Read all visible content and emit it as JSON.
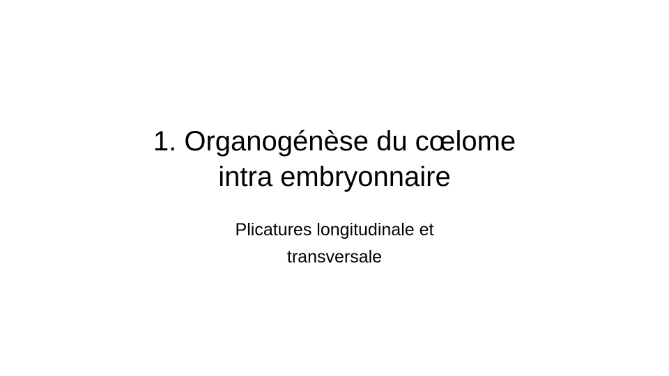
{
  "slide": {
    "title_lines": [
      "1. Organogénèse du cœlome",
      "intra embryonnaire"
    ],
    "subtitle_lines": [
      "Plicatures longitudinale et",
      "transversale"
    ]
  }
}
